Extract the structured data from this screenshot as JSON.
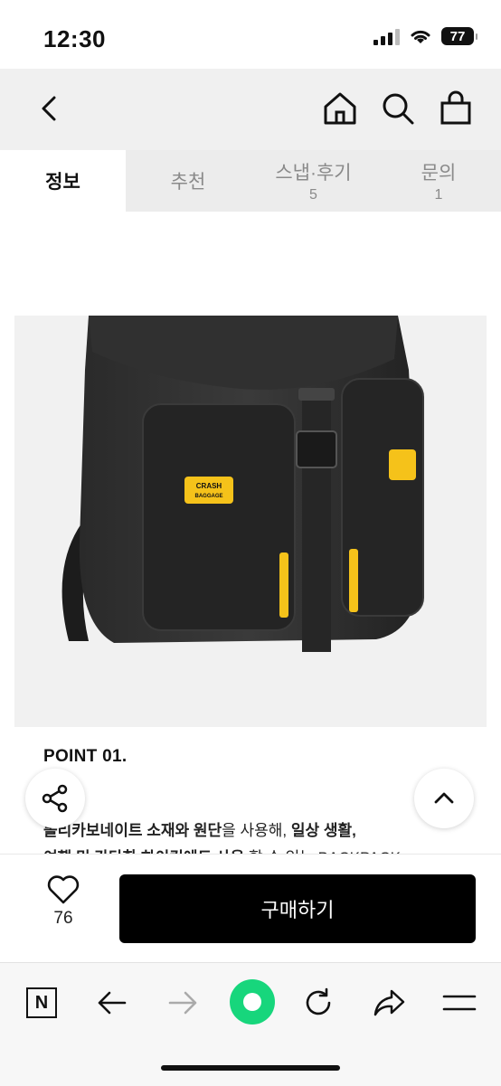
{
  "status": {
    "time": "12:30",
    "battery": "77"
  },
  "nav": {
    "back": "back",
    "icons": [
      "home-icon",
      "search-icon",
      "shopping-bag-icon"
    ]
  },
  "tabs": [
    {
      "label": "정보",
      "count": ""
    },
    {
      "label": "추천",
      "count": ""
    },
    {
      "label": "스냅·후기",
      "count": "5"
    },
    {
      "label": "문의",
      "count": "1"
    }
  ],
  "product": {
    "badge_line1": "CRASH",
    "badge_line2": "BAGGAGE",
    "point_title": "POINT 01.",
    "desc1_bold": "폴리카보네이트 소재와 원단",
    "desc1_rest": "을 사용해, ",
    "desc1_bold2": "일상 생활,",
    "desc2_bold": "여행 및 간단한 하이킹에도 사용",
    "desc2_rest": " 할 수 있는 BACKPACK"
  },
  "purchase": {
    "like_count": "76",
    "buy_label": "구매하기"
  },
  "browser": {
    "n_label": "N"
  },
  "colors": {
    "accent_green": "#17d67c",
    "badge_yellow": "#f5c21a",
    "tab_bg": "#ececec"
  }
}
